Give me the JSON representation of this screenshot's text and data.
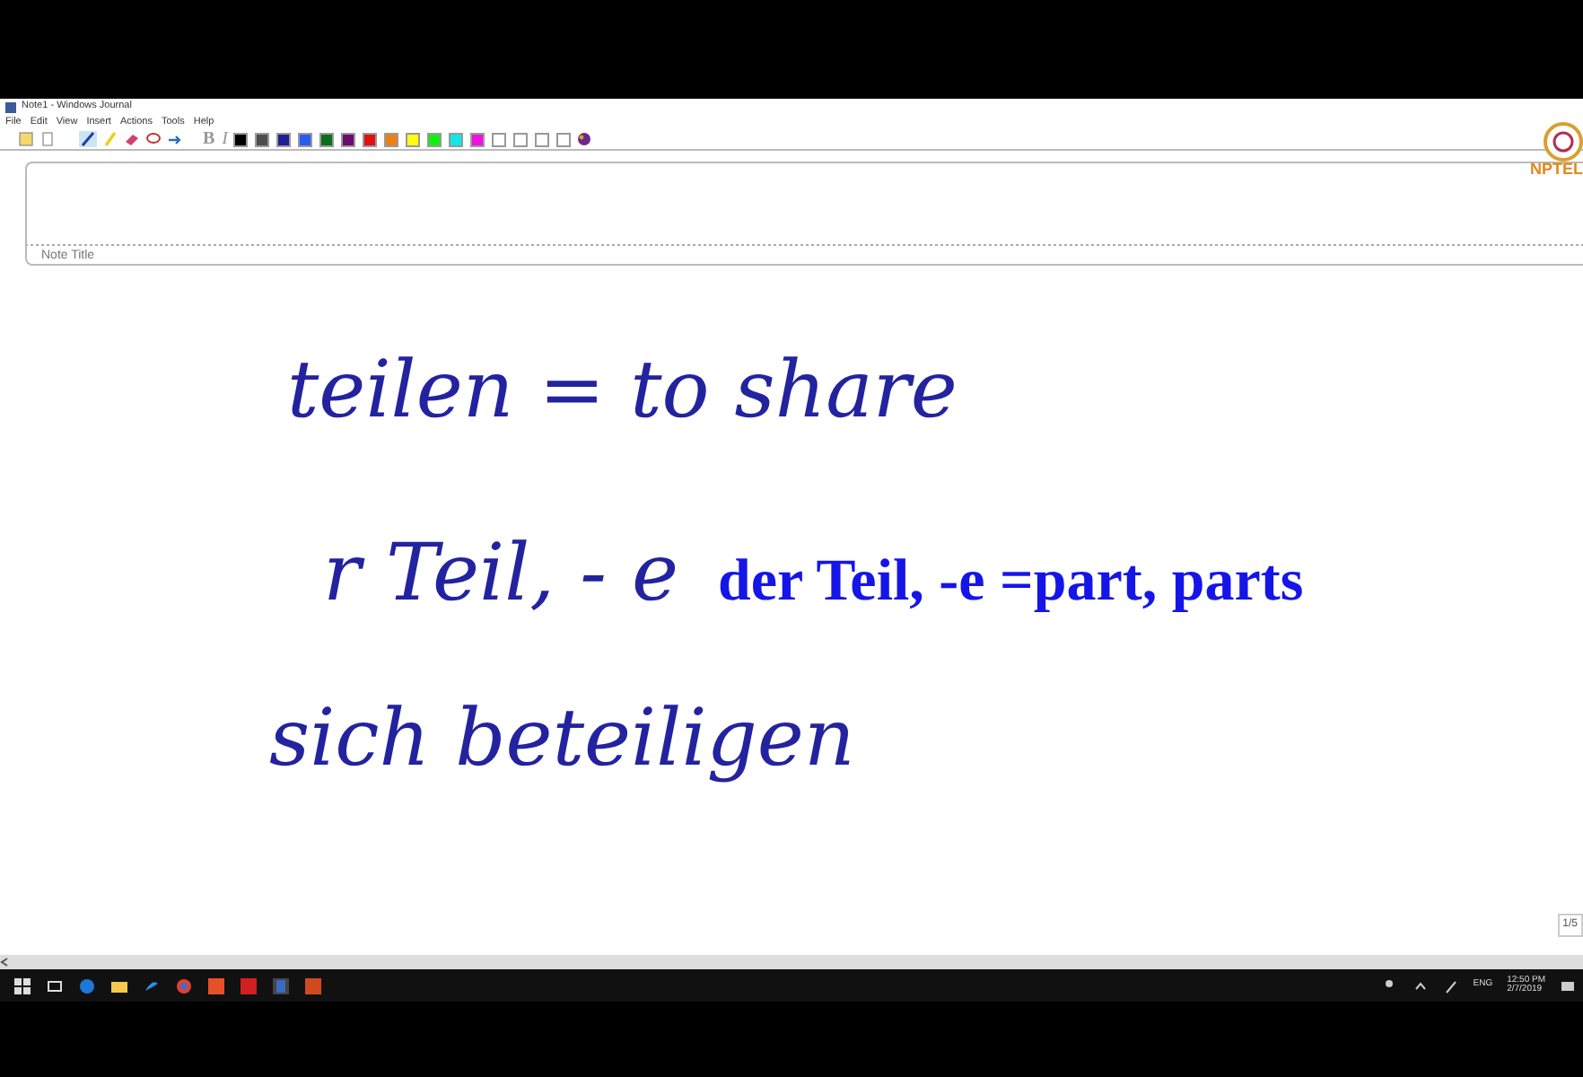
{
  "window": {
    "title": "Note1 - Windows Journal"
  },
  "menu": [
    "File",
    "Edit",
    "View",
    "Insert",
    "Actions",
    "Tools",
    "Help"
  ],
  "toolbar": {
    "format_buttons": [
      "B",
      "I"
    ],
    "swatches": [
      {
        "color": "#000000"
      },
      {
        "color": "#4d4d4d"
      },
      {
        "color": "#1f1f8f"
      },
      {
        "color": "#2a5bf0"
      },
      {
        "color": "#0b6e1e"
      },
      {
        "color": "#6a0b6e"
      },
      {
        "color": "#e01010"
      },
      {
        "color": "#f08010"
      },
      {
        "color": "#ffff10"
      },
      {
        "color": "#10f010"
      },
      {
        "color": "#10e8e8"
      },
      {
        "color": "#f010e0"
      },
      {
        "color": "#ffffff"
      },
      {
        "color": "#ffffff"
      },
      {
        "color": "#ffffff"
      },
      {
        "color": "#ffffff"
      }
    ]
  },
  "logo": {
    "text": "NPTEL"
  },
  "note": {
    "title_placeholder": "Note Title",
    "handwriting": [
      {
        "text": "teilen = to share"
      },
      {
        "text": "r Teil, - e"
      },
      {
        "text": "sich beteiligen"
      }
    ],
    "typed_annotation": "der Teil, -e =part, parts"
  },
  "page_indicator": "1/5",
  "taskbar": {
    "language": "ENG",
    "time": "12:50 PM",
    "date": "2/7/2019"
  }
}
